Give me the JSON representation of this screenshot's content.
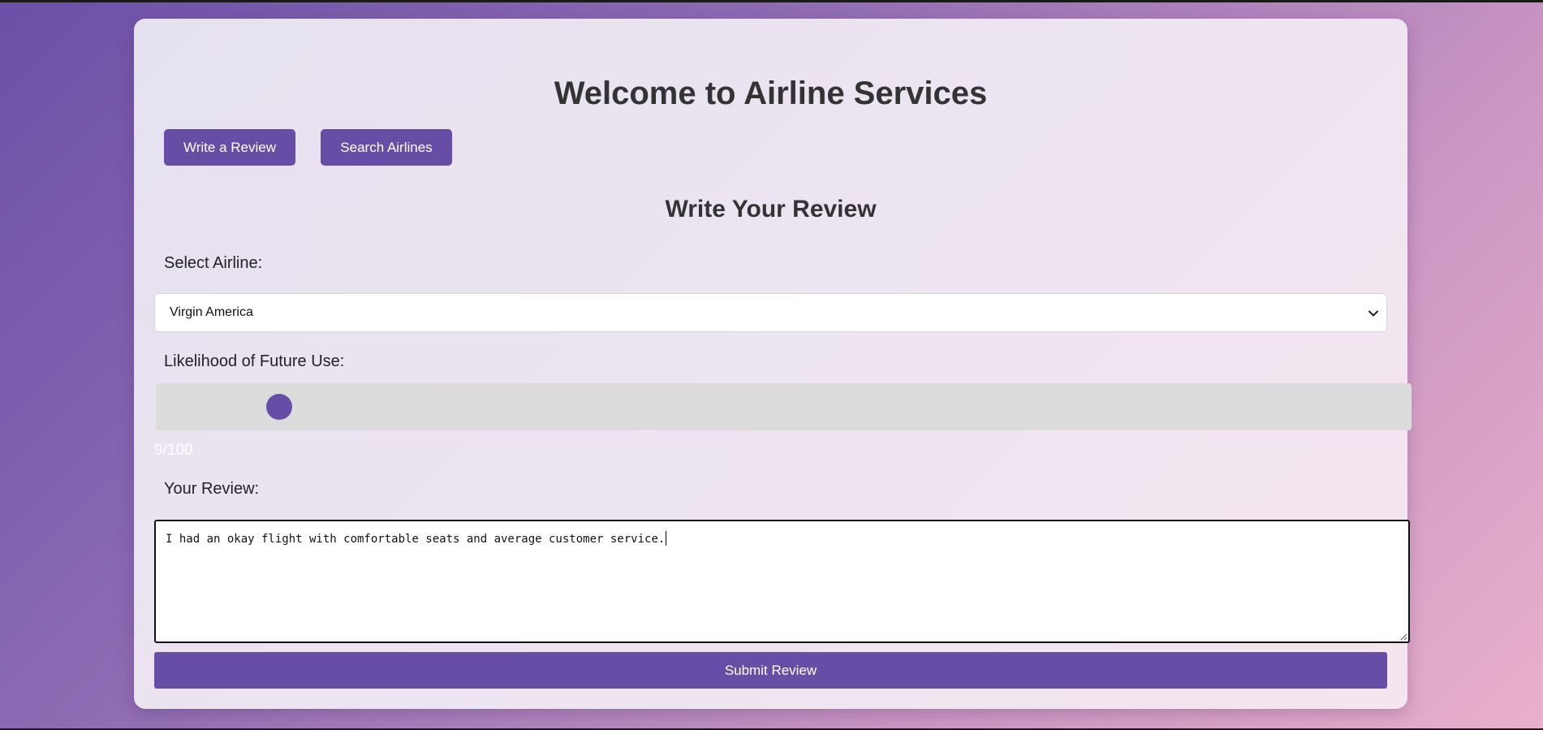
{
  "page": {
    "title": "Welcome to Airline Services"
  },
  "nav": {
    "write_review_label": "Write a Review",
    "search_airlines_label": "Search Airlines"
  },
  "review_form": {
    "heading": "Write Your Review",
    "airline_label": "Select Airline:",
    "airline_selected": "Virgin America",
    "likelihood_label": "Likelihood of Future Use:",
    "likelihood_value": 9,
    "likelihood_display": "9/100",
    "review_label": "Your Review:",
    "review_text": "I had an okay flight with comfortable seats and average customer service.",
    "submit_label": "Submit Review"
  },
  "colors": {
    "accent": "#664ea6",
    "heading": "#333333",
    "track": "#dcdcdc"
  },
  "icons": {
    "select_arrow": "chevron-down-icon",
    "textarea_grip": "resize-grip-icon"
  }
}
